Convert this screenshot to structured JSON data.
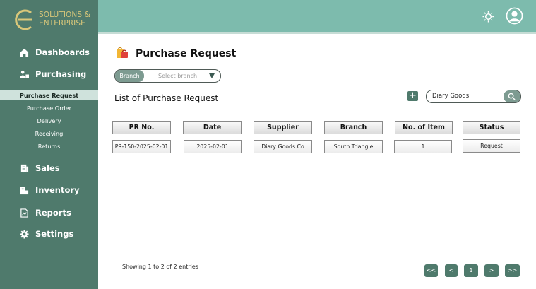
{
  "brand": {
    "line1": "SOLUTIONS &",
    "line2": "ENTERPRISE",
    "accent": "#d9c77a"
  },
  "colors": {
    "sidebar": "#4f7a6c",
    "topbar": "#7dbbad",
    "active_sub": "#cfe2dc"
  },
  "sidebar": {
    "main_items": [
      {
        "label": "Dashboards",
        "icon": "home-icon"
      },
      {
        "label": "Purchasing",
        "icon": "users-icon"
      },
      {
        "label": "Sales",
        "icon": "receipt-icon"
      },
      {
        "label": "Inventory",
        "icon": "inventory-icon"
      },
      {
        "label": "Reports",
        "icon": "report-icon"
      },
      {
        "label": "Settings",
        "icon": "gear-icon"
      }
    ],
    "sub_items": [
      {
        "label": "Purchase Request",
        "active": true
      },
      {
        "label": "Purchase Order"
      },
      {
        "label": "Delivery"
      },
      {
        "label": "Receiving"
      },
      {
        "label": "Returns"
      }
    ]
  },
  "header": {
    "theme_icon": "sun-icon",
    "profile_icon": "user-avatar-icon"
  },
  "main": {
    "title": "Purchase Request",
    "title_icon": "shopping-bags-icon",
    "branch": {
      "label": "Branch",
      "placeholder": "Select branch"
    },
    "list_title": "List of Purchase Request",
    "add_label": "+",
    "search": {
      "value": "Diary Goods",
      "icon": "search-icon"
    },
    "columns": [
      "PR No.",
      "Date",
      "Supplier",
      "Branch",
      "No. of Item",
      "Status"
    ],
    "rows": [
      [
        "PR-150-2025-02-01",
        "2025-02-01",
        "Diary Goods Co",
        "South Triangle",
        "1",
        "Request"
      ]
    ],
    "showing": "Showing 1 to 2 of 2 entries",
    "pagination": [
      "<<",
      "<",
      "1",
      ">",
      ">>"
    ]
  }
}
